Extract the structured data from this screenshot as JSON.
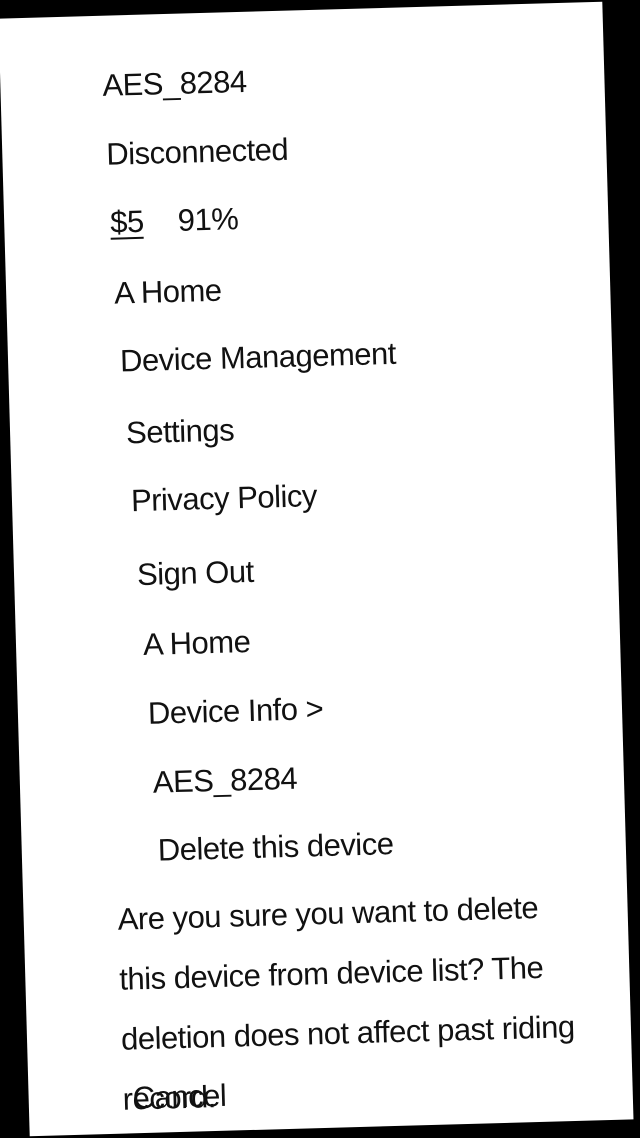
{
  "drawer": {
    "device_name": "AES_8284",
    "connection_status": "Disconnected",
    "speed": "$5",
    "battery": "91%",
    "menu": [
      {
        "label": "A Home"
      },
      {
        "label": "Device Management"
      },
      {
        "label": "Settings"
      },
      {
        "label": "Privacy Policy"
      },
      {
        "label": "Sign Out"
      }
    ]
  },
  "main": {
    "nav_home": "A Home",
    "breadcrumb": "Device Info >",
    "device_name": "AES_8284",
    "delete_device": "Delete this device"
  },
  "dialog": {
    "message": "Are you sure you want to delete this device from device list? The deletion does not affect past riding record.",
    "cancel_label": "Cancel"
  },
  "colors": {
    "background": "#000000",
    "sheet": "#ffffff",
    "text": "#111111"
  }
}
